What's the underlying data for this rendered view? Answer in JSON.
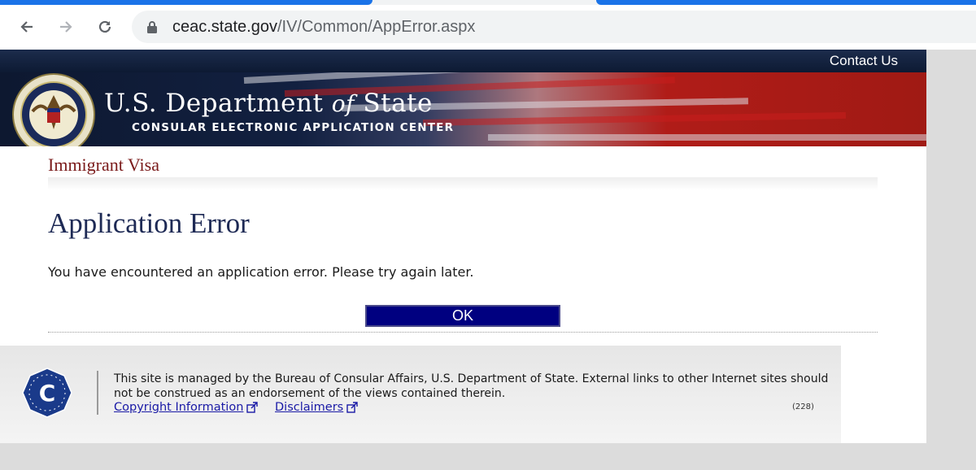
{
  "browser": {
    "url_host": "ceac.state.gov",
    "url_path": "/IV/Common/AppError.aspx"
  },
  "header": {
    "contact_label": "Contact Us",
    "title_pre": "U.S. Department ",
    "title_of": "of",
    "title_post": " State",
    "subtitle": "CONSULAR ELECTRONIC APPLICATION CENTER",
    "seal_text": "DEPARTMENT OF STATE • UNITED STATES OF AMERICA"
  },
  "main": {
    "section": "Immigrant Visa",
    "error_title": "Application Error",
    "error_message": "You have encountered an application error. Please try again later.",
    "ok_label": "OK"
  },
  "footer": {
    "logo_letter": "C",
    "notice": "This site is managed by the Bureau of Consular Affairs, U.S. Department of State. External links to other Internet sites should not be construed as an endorsement of the views contained therein.",
    "links": [
      "Copyright Information",
      "Disclaimers"
    ],
    "counter": "(228)"
  },
  "colors": {
    "accent_blue": "#1a73e8",
    "ok_button": "#000080",
    "section_title": "#7a1a1a",
    "error_title": "#1e2a55"
  },
  "icons": [
    "back-arrow-icon",
    "forward-arrow-icon",
    "reload-icon",
    "lock-icon",
    "external-link-icon"
  ]
}
